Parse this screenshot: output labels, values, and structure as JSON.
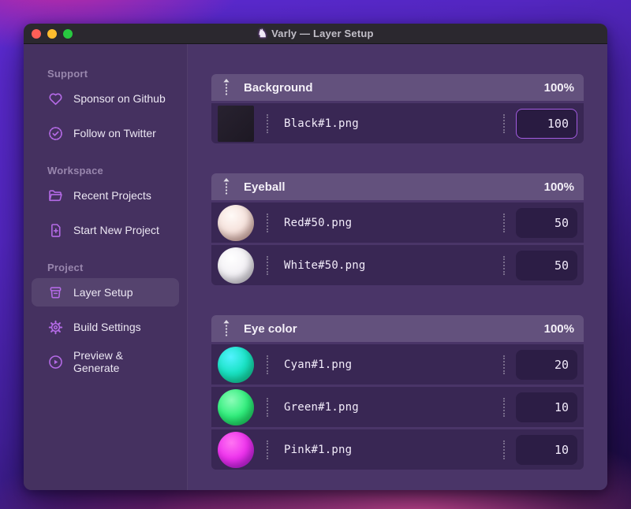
{
  "window": {
    "title": "Varly — Layer Setup",
    "icon_glyph": "♞"
  },
  "colors": {
    "accent": "#a35ce0",
    "sidebar_icon": "#b46ae6",
    "focus_ring": "#a35ce0",
    "desktop_pink": "#f456a8",
    "desktop_violet": "#5e2bd6"
  },
  "sidebar": {
    "sections": [
      {
        "label": "Support",
        "items": [
          {
            "label": "Sponsor on Github",
            "icon": "heart-icon"
          },
          {
            "label": "Follow on Twitter",
            "icon": "verified-check-icon"
          }
        ]
      },
      {
        "label": "Workspace",
        "items": [
          {
            "label": "Recent Projects",
            "icon": "folder-icon"
          },
          {
            "label": "Start New Project",
            "icon": "new-document-icon"
          }
        ]
      },
      {
        "label": "Project",
        "items": [
          {
            "label": "Layer Setup",
            "icon": "archive-box-icon",
            "selected": true
          },
          {
            "label": "Build Settings",
            "icon": "gear-icon"
          },
          {
            "label": "Preview & Generate",
            "icon": "play-circle-icon"
          }
        ]
      }
    ]
  },
  "layers": {
    "groups": [
      {
        "name": "Background",
        "weight": "100%",
        "rows": [
          {
            "file": "Black#1.png",
            "value": "100",
            "thumb": "black-square",
            "focused": "true"
          }
        ]
      },
      {
        "name": "Eyeball",
        "weight": "100%",
        "rows": [
          {
            "file": "Red#50.png",
            "value": "50",
            "thumb": "red-sphere",
            "focused": "false"
          },
          {
            "file": "White#50.png",
            "value": "50",
            "thumb": "white-sphere",
            "focused": "false"
          }
        ]
      },
      {
        "name": "Eye color",
        "weight": "100%",
        "rows": [
          {
            "file": "Cyan#1.png",
            "value": "20",
            "thumb": "cyan-sphere",
            "focused": "false"
          },
          {
            "file": "Green#1.png",
            "value": "10",
            "thumb": "green-sphere",
            "focused": "false"
          },
          {
            "file": "Pink#1.png",
            "value": "10",
            "thumb": "pink-sphere",
            "focused": "false"
          }
        ]
      }
    ]
  }
}
